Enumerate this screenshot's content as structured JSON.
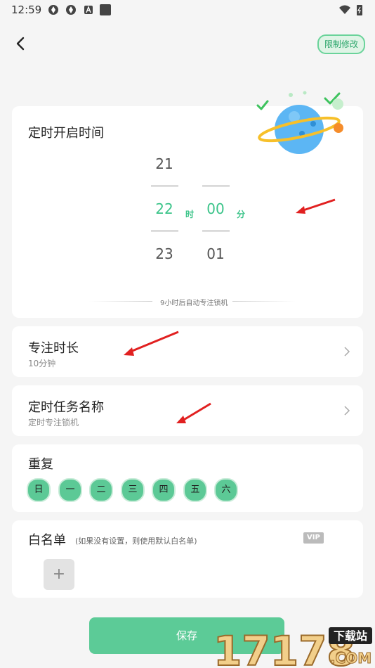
{
  "status_bar": {
    "time": "12:59"
  },
  "header": {
    "limit_button": "限制修改"
  },
  "timer_card": {
    "title": "定时开启时间",
    "hours": [
      "21",
      "22",
      "23"
    ],
    "minutes": [
      "00",
      "01"
    ],
    "hour_unit": "时",
    "minute_unit": "分",
    "hint": "9小时后自动专注锁机"
  },
  "duration_card": {
    "title": "专注时长",
    "value": "10分钟"
  },
  "task_name_card": {
    "title": "定时任务名称",
    "value": "定时专注锁机"
  },
  "repeat_card": {
    "title": "重复",
    "days": [
      "日",
      "一",
      "二",
      "三",
      "四",
      "五",
      "六"
    ]
  },
  "whitelist_card": {
    "title": "白名单",
    "note": "(如果没有设置，则使用默认白名单)",
    "vip_badge": "VIP",
    "add_label": "+"
  },
  "save_button": "保存",
  "watermark": {
    "number": "17178",
    "label": "下载站",
    "domain": ".COM"
  },
  "colors": {
    "accent": "#5ccb97",
    "selected_text": "#3cc48a",
    "background": "#f5f5f5"
  }
}
